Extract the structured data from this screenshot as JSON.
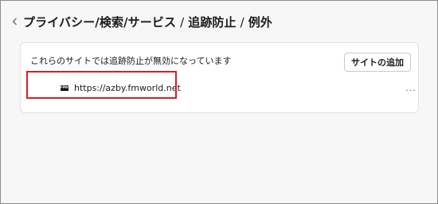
{
  "header": {
    "back_icon": "chevron-left-icon",
    "breadcrumb": [
      "プライバシー/検索/サービス",
      "追跡防止",
      "例外"
    ],
    "separator": "/"
  },
  "exceptions": {
    "description": "これらのサイトでは追跡防止が無効になっています",
    "add_button_label": "サイトの追加",
    "sites": [
      {
        "url": "https://azby.fmworld.net",
        "favicon_text": "FMV",
        "more_label": "..."
      }
    ]
  },
  "colors": {
    "highlight": "#d42127",
    "background": "#f7f7f7",
    "card": "#ffffff"
  }
}
